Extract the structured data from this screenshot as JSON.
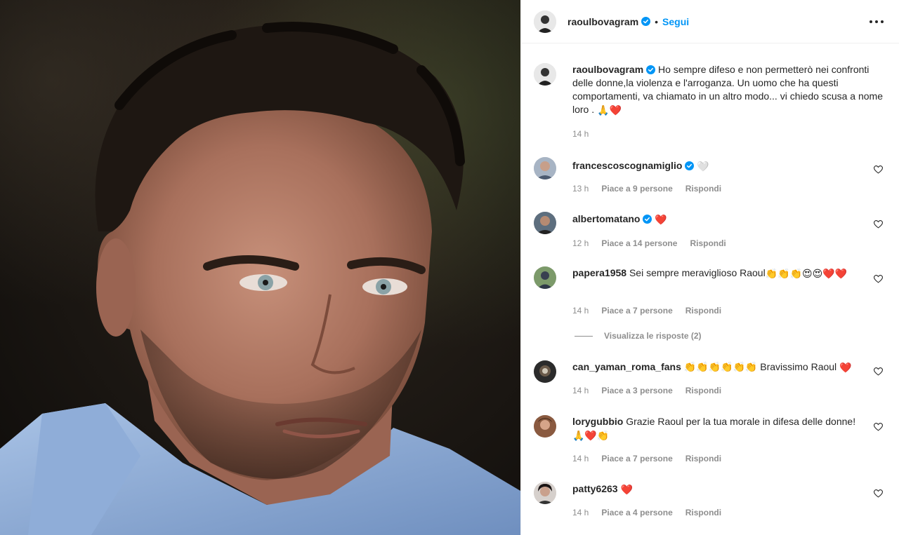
{
  "post": {
    "username": "raoulbovagram",
    "verified": true,
    "separator": "•",
    "follow_label": "Segui"
  },
  "caption": {
    "username": "raoulbovagram",
    "text": "Ho sempre difeso e non permetterò nei confronti delle donne,la violenza e l'arroganza. Un uomo che ha questi comportamenti, va chiamato in un altro modo... vi chiedo scusa a nome loro . ",
    "emojis": "🙏❤️",
    "time": "14 h"
  },
  "comments": [
    {
      "username": "francescoscognamiglio",
      "verified": true,
      "text": "",
      "emojis": "🤍",
      "time": "13 h",
      "likes": "Piace a 9 persone",
      "reply_label": "Rispondi"
    },
    {
      "username": "albertomatano",
      "verified": true,
      "text": "",
      "emojis": "❤️",
      "time": "12 h",
      "likes": "Piace a 14 persone",
      "reply_label": "Rispondi"
    },
    {
      "username": "papera1958",
      "verified": false,
      "text": "Sei sempre meraviglioso Raoul",
      "emojis": "👏👏👏😍😍❤️❤️",
      "time": "14 h",
      "likes": "Piace a 7 persone",
      "reply_label": "Rispondi",
      "view_replies": "Visualizza le risposte (2)"
    },
    {
      "username": "can_yaman_roma_fans",
      "verified": false,
      "text": "👏👏👏👏👏👏 Bravissimo Raoul ",
      "emojis": "❤️",
      "time": "14 h",
      "likes": "Piace a 3 persone",
      "reply_label": "Rispondi"
    },
    {
      "username": "lorygubbio",
      "verified": false,
      "text": "Grazie Raoul per la tua morale in difesa delle donne! ",
      "emojis": "🙏❤️👏",
      "time": "14 h",
      "likes": "Piace a 7 persone",
      "reply_label": "Rispondi"
    },
    {
      "username": "patty6263",
      "verified": false,
      "text": "",
      "emojis": "❤️",
      "time": "14 h",
      "likes": "Piace a 4 persone",
      "reply_label": "Rispondi"
    }
  ],
  "icons": {
    "more": "more-options-icon",
    "verified": "verified-badge-icon",
    "like": "heart-outline-icon"
  },
  "colors": {
    "link": "#0095f6",
    "verified": "#0095f6",
    "meta": "#8e8e8e",
    "heart": "#ed4956"
  }
}
